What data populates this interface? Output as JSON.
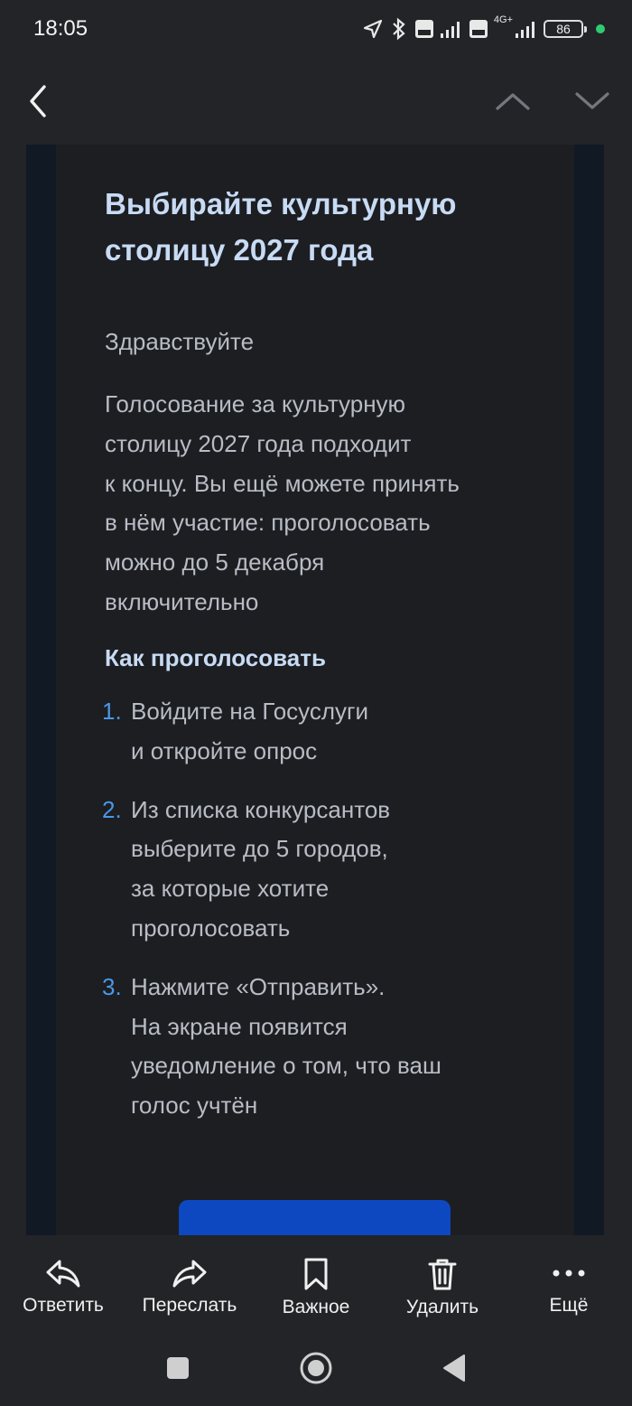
{
  "status_bar": {
    "time": "18:05",
    "battery": "86",
    "network_label": "4G+"
  },
  "toolbar": {
    "back_icon": "chevron-left-icon",
    "prev_icon": "chevron-up-icon",
    "next_icon": "chevron-down-icon"
  },
  "email": {
    "title": "Выбирайте культурную столицу 2027 года",
    "greeting": "Здравствуйте",
    "paragraph": "Голосование за культурную\nстолицу 2027 года подходит\nк концу. Вы ещё можете принять\nв нём участие: проголосовать\nможно до 5 декабря\nвключительно",
    "subheading": "Как проголосовать",
    "steps": [
      {
        "num": "1.",
        "text": "Войдите на Госуслуги\nи откройте опрос"
      },
      {
        "num": "2.",
        "text": "Из списка конкурсантов\nвыберите до 5 городов,\nза которые хотите\nпроголосовать"
      },
      {
        "num": "3.",
        "text": "Нажмите «Отправить».\nНа экране появится\nуведомление о том, что ваш\nголос учтён"
      }
    ],
    "accent_color": "#4b97e8",
    "button_color": "#0d48c0"
  },
  "bottom_actions": [
    {
      "label": "Ответить",
      "icon": "reply-icon"
    },
    {
      "label": "Переслать",
      "icon": "forward-icon"
    },
    {
      "label": "Важное",
      "icon": "bookmark-icon"
    },
    {
      "label": "Удалить",
      "icon": "trash-icon"
    },
    {
      "label": "Ещё",
      "icon": "more-icon"
    }
  ],
  "nav_bar": {
    "recents_icon": "square-icon",
    "home_icon": "circle-icon",
    "back_icon": "triangle-back-icon"
  }
}
